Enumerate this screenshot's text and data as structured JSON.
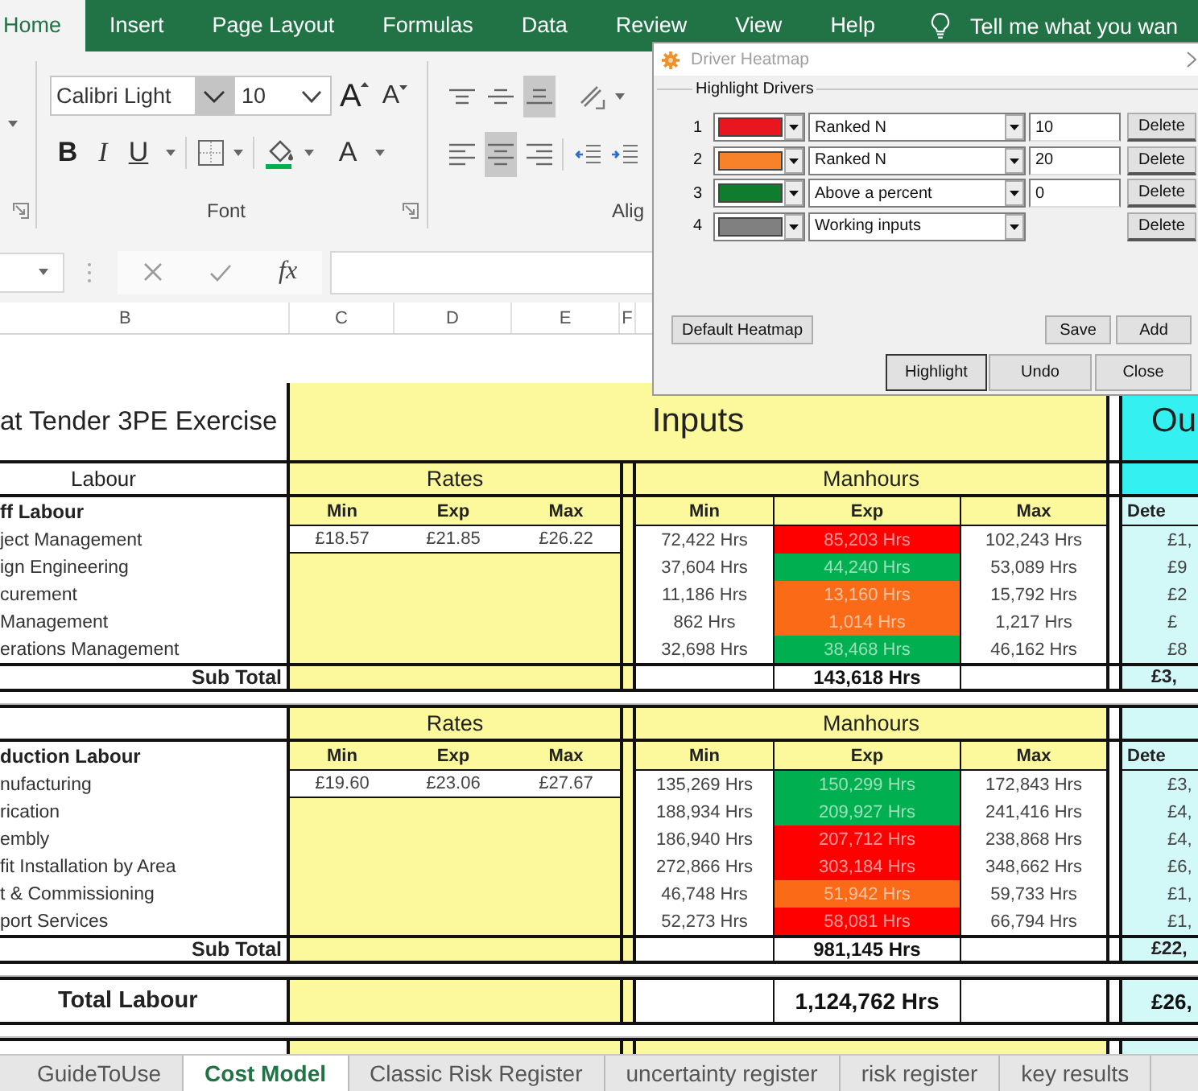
{
  "ribbon": {
    "tabs": [
      {
        "label": "Home",
        "selected": true
      },
      {
        "label": "Insert",
        "selected": false
      },
      {
        "label": "Page Layout",
        "selected": false
      },
      {
        "label": "Formulas",
        "selected": false
      },
      {
        "label": "Data",
        "selected": false
      },
      {
        "label": "Review",
        "selected": false
      },
      {
        "label": "View",
        "selected": false
      },
      {
        "label": "Help",
        "selected": false
      }
    ],
    "tell_me": "Tell me what you wan"
  },
  "font_group": {
    "font_name": "Calibri Light",
    "font_size": "10",
    "grow_font": "A",
    "shrink_font": "A",
    "bold": "B",
    "italic": "I",
    "underline": "U",
    "font_color": "A",
    "label": "Font"
  },
  "alignment_group": {
    "vertical": [
      {
        "kind": "top",
        "selected": false
      },
      {
        "kind": "middle",
        "selected": false
      },
      {
        "kind": "bottom",
        "selected": true
      }
    ],
    "horizontal": [
      {
        "kind": "left",
        "selected": false
      },
      {
        "kind": "center",
        "selected": true
      },
      {
        "kind": "right",
        "selected": false
      }
    ],
    "label": "Alig"
  },
  "formula_bar": {
    "function_label": "fx"
  },
  "column_headers": [
    "B",
    "C",
    "D",
    "E",
    "F"
  ],
  "sheet": {
    "title": "at Tender 3PE Exercise",
    "inputs_label": "Inputs",
    "outputs_label": "Ou",
    "sections": [
      {
        "header": "Labour",
        "rates_label": "Rates",
        "manhours_label": "Manhours",
        "group_label": "ff Labour",
        "rate_columns": [
          "Min",
          "Exp",
          "Max"
        ],
        "manhour_columns": [
          "Min",
          "Exp",
          "Max"
        ],
        "output_column": "Dete",
        "rows": [
          {
            "name": "ject Management",
            "rates": [
              "£18.57",
              "£21.85",
              "£26.22"
            ],
            "min": "72,422 Hrs",
            "exp": "85,203 Hrs",
            "color": "#ff0000",
            "max": "102,243 Hrs",
            "output": "£1,"
          },
          {
            "name": "ign Engineering",
            "min": "37,604 Hrs",
            "exp": "44,240 Hrs",
            "color": "#00b050",
            "max": "53,089 Hrs",
            "output": "£9"
          },
          {
            "name": "curement",
            "min": "11,186 Hrs",
            "exp": "13,160 Hrs",
            "color": "#fb6a16",
            "max": "15,792 Hrs",
            "output": "£2"
          },
          {
            "name": "Management",
            "min": "862 Hrs",
            "exp": "1,014 Hrs",
            "color": "#fb6a16",
            "max": "1,217 Hrs",
            "output": "£"
          },
          {
            "name": "erations Management",
            "min": "32,698 Hrs",
            "exp": "38,468 Hrs",
            "color": "#00b050",
            "max": "46,162 Hrs",
            "output": "£8"
          }
        ],
        "subtotal": {
          "label": "Sub Total",
          "exp": "143,618 Hrs",
          "output": "£3,"
        }
      },
      {
        "rates_label": "Rates",
        "manhours_label": "Manhours",
        "group_label": "duction Labour",
        "rate_columns": [
          "Min",
          "Exp",
          "Max"
        ],
        "manhour_columns": [
          "Min",
          "Exp",
          "Max"
        ],
        "output_column": "Dete",
        "rows": [
          {
            "name": "nufacturing",
            "rates": [
              "£19.60",
              "£23.06",
              "£27.67"
            ],
            "min": "135,269 Hrs",
            "exp": "150,299 Hrs",
            "color": "#00b050",
            "max": "172,843 Hrs",
            "output": "£3,"
          },
          {
            "name": "rication",
            "min": "188,934 Hrs",
            "exp": "209,927 Hrs",
            "color": "#00b050",
            "max": "241,416 Hrs",
            "output": "£4,"
          },
          {
            "name": "embly",
            "min": "186,940 Hrs",
            "exp": "207,712 Hrs",
            "color": "#ff0000",
            "max": "238,868 Hrs",
            "output": "£4,"
          },
          {
            "name": "fit Installation by Area",
            "min": "272,866 Hrs",
            "exp": "303,184 Hrs",
            "color": "#ff0000",
            "max": "348,662 Hrs",
            "output": "£6,"
          },
          {
            "name": "t & Commissioning",
            "min": "46,748 Hrs",
            "exp": "51,942 Hrs",
            "color": "#fb6a16",
            "max": "59,733 Hrs",
            "output": "£1,"
          },
          {
            "name": "port Services",
            "min": "52,273 Hrs",
            "exp": "58,081 Hrs",
            "color": "#ff0000",
            "max": "66,794 Hrs",
            "output": "£1,"
          }
        ],
        "subtotal": {
          "label": "Sub Total",
          "exp": "981,145 Hrs",
          "output": "£22,"
        }
      }
    ],
    "total": {
      "label": "Total Labour",
      "exp": "1,124,762 Hrs",
      "output": "£26,"
    }
  },
  "sheet_tabs": [
    {
      "label": "GuideToUse",
      "selected": false
    },
    {
      "label": "Cost Model",
      "selected": true
    },
    {
      "label": "Classic Risk Register",
      "selected": false
    },
    {
      "label": "uncertainty register",
      "selected": false
    },
    {
      "label": "risk register",
      "selected": false
    },
    {
      "label": "key results",
      "selected": false
    }
  ],
  "dialog": {
    "title": "Driver Heatmap",
    "group_label": "Highlight Drivers",
    "drivers": [
      {
        "number": "1",
        "color": "#e8161e",
        "rule": "Ranked N",
        "value": "10",
        "delete": "Delete"
      },
      {
        "number": "2",
        "color": "#f7822a",
        "rule": "Ranked N",
        "value": "20",
        "delete": "Delete"
      },
      {
        "number": "3",
        "color": "#107c2e",
        "rule": "Above a percent",
        "value": "0",
        "delete": "Delete"
      },
      {
        "number": "4",
        "color": "#808080",
        "rule": "Working inputs",
        "delete": "Delete"
      }
    ],
    "buttons": {
      "default_heatmap": "Default Heatmap",
      "save": "Save",
      "add": "Add",
      "highlight": "Highlight",
      "undo": "Undo",
      "close": "Close"
    }
  }
}
